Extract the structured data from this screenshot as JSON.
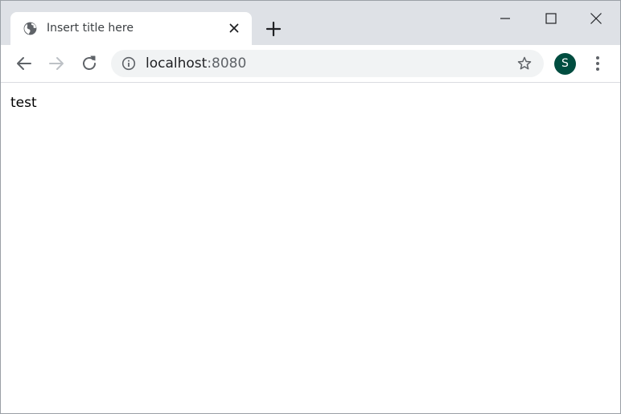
{
  "tab": {
    "title": "Insert title here",
    "favicon": "globe-icon"
  },
  "toolbar": {
    "url_host": "localhost",
    "url_port": ":8080",
    "avatar_letter": "S"
  },
  "page": {
    "body_text": "test"
  },
  "colors": {
    "tabstrip": "#dee1e6",
    "omnibox": "#f1f3f4",
    "avatar": "#004d40"
  }
}
